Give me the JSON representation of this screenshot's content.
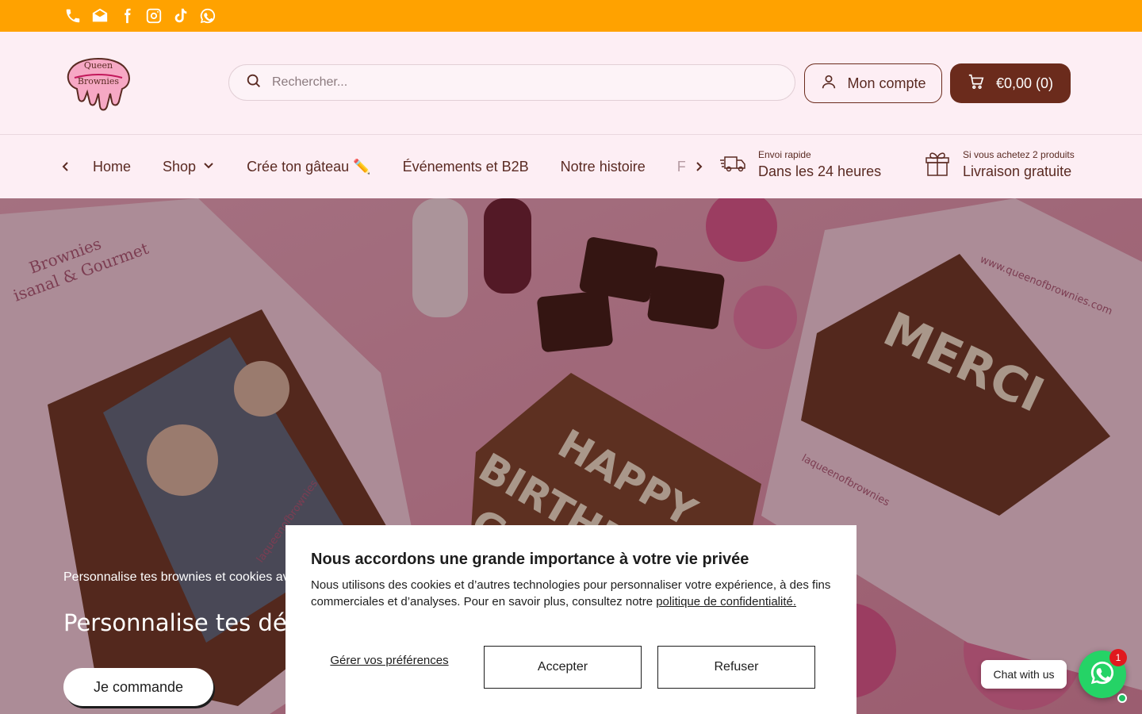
{
  "topbar": {
    "icons": [
      "phone-icon",
      "email-icon",
      "facebook-icon",
      "instagram-icon",
      "tiktok-icon",
      "whatsapp-icon"
    ],
    "background": "#ffa200"
  },
  "header": {
    "logo_text_line1": "Queen",
    "logo_text_line2": "Brownies",
    "search_placeholder": "Rechercher...",
    "account_label": "Mon compte",
    "cart_label": "€0,00 (0)"
  },
  "nav": {
    "items": [
      {
        "label": "Home"
      },
      {
        "label": "Shop"
      },
      {
        "label": "Crée ton gâteau ✏️"
      },
      {
        "label": "Événements et B2B"
      },
      {
        "label": "Notre histoire"
      },
      {
        "label": "F"
      }
    ]
  },
  "perks": [
    {
      "small": "Envoi rapide",
      "big": "Dans les 24 heures",
      "icon": "truck-icon"
    },
    {
      "small": "Si vous achetez 2 produits",
      "big": "Livraison gratuite",
      "icon": "gift-icon"
    }
  ],
  "hero": {
    "subtitle": "Personnalise tes brownies et cookies av",
    "headline": "Personnalise tes déli",
    "cta": "Je commande",
    "image_texts": {
      "box_left_1": "Brownies",
      "box_left_2": "isanal & Gourmet",
      "center_cake_1": "HAPPY",
      "center_cake_2": "BIRTHD",
      "center_cake_3": "G",
      "right_cake": "MERCI",
      "box_right_url": "www.queenofbrownies.com",
      "box_bottom_brand": "laqueenofbrownies",
      "box_left_brand": "laqueenofbrownies"
    }
  },
  "cookie": {
    "title": "Nous accordons une grande importance à votre vie privée",
    "body": "Nous utilisons des cookies et d’autres technologies pour personnaliser votre expérience, à des fins commerciales et d’analyses. Pour en savoir plus, consultez notre ",
    "link": "politique de confidentialité.",
    "manage": "Gérer vos préférences",
    "accept": "Accepter",
    "refuse": "Refuser"
  },
  "chat": {
    "label": "Chat with us",
    "badge": "1"
  },
  "colors": {
    "brand_brown": "#6b2b1c",
    "header_bg": "#fdeef4",
    "whatsapp_green": "#25d366"
  }
}
